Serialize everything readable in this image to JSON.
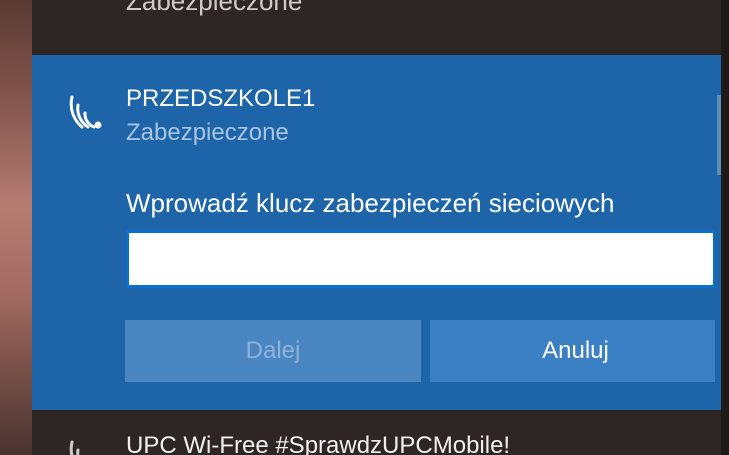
{
  "previous_network": {
    "status_label": "Zabezpieczone"
  },
  "selected_network": {
    "icon": "wifi-secured-icon",
    "name": "PRZEDSZKOLE1",
    "status": "Zabezpieczone",
    "key_prompt": "Wprowadź klucz zabezpieczeń sieciowych",
    "key_value": "",
    "next_label": "Dalej",
    "cancel_label": "Anuluj"
  },
  "next_network": {
    "icon": "wifi-icon",
    "name": "UPC Wi-Free #SprawdzUPCMobile!"
  },
  "colors": {
    "accent": "#1d64a8",
    "panel": "#2d2624",
    "input_border": "#0a70cc"
  }
}
